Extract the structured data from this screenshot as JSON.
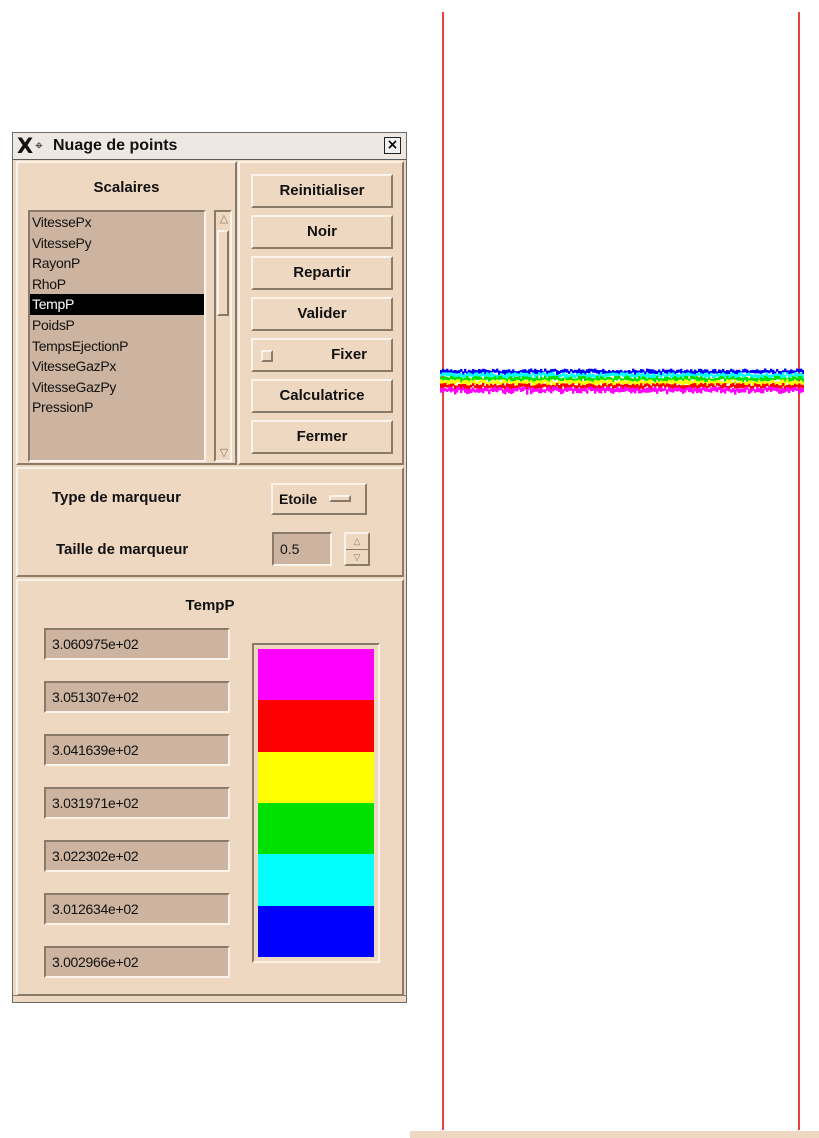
{
  "window": {
    "title": "Nuage de points",
    "title_icons": [
      "x-logo-icon",
      "pin-icon"
    ],
    "close_icon": "close-icon",
    "close_glyph": "×"
  },
  "scalaires": {
    "title": "Scalaires",
    "items": [
      "VitesseP x",
      "VitessePy",
      "RayonP",
      "RhoP",
      "TempP",
      "PoidsP",
      "TempsEjectionP",
      "VitesseGazPx",
      "VitesseGazPy",
      "PressionP"
    ],
    "selected": "TempP"
  },
  "buttons": {
    "reinitialiser": "Reinitialiser",
    "noir": "Noir",
    "repartir": "Repartir",
    "valider": "Valider",
    "fixer": "Fixer",
    "calculatrice": "Calculatrice",
    "fermer": "Fermer"
  },
  "marker": {
    "type_label": "Type de marqueur",
    "type_value": "Etoile",
    "size_label": "Taille de marqueur",
    "size_value": "0.5"
  },
  "legend": {
    "title": "TempP",
    "values": [
      "3.060975e+02",
      "3.051307e+02",
      "3.041639e+02",
      "3.031971e+02",
      "3.022302e+02",
      "3.012634e+02",
      "3.002966e+02"
    ],
    "colors": [
      "#ff00ff",
      "#ff0000",
      "#ffff00",
      "#00e000",
      "#00ffff",
      "#0000ff"
    ]
  },
  "plot": {
    "line_color": "#e8423a",
    "band_colors": [
      "#0000ff",
      "#00ffff",
      "#00e000",
      "#ffff00",
      "#ff0000",
      "#ff00ff"
    ]
  }
}
